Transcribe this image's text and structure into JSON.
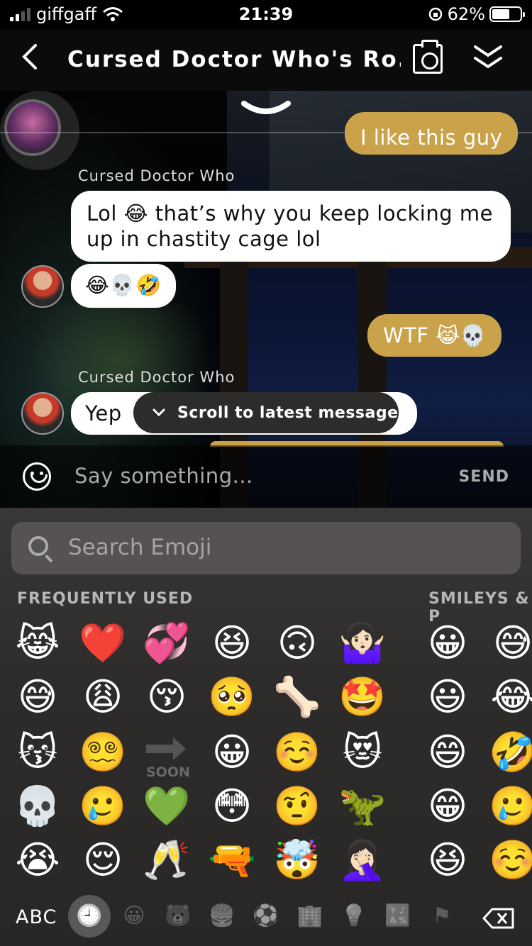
{
  "status": {
    "carrier": "giffgaff",
    "time": "21:39",
    "battery": "62%",
    "battery_level": 0.62
  },
  "header": {
    "title": "Cursed Doctor Who's Ro..."
  },
  "chat": {
    "partial_message": "I like this guy",
    "sender1": "Cursed Doctor Who",
    "msg1": "Lol 😂 that’s why you keep locking me up in chastity cage lol",
    "msg2": "😂💀🤣",
    "msg3": "WTF 😹💀",
    "sender2": "Cursed Doctor Who",
    "msg4": "Yep",
    "scroll_label": "Scroll to latest message"
  },
  "input": {
    "placeholder": "Say something...",
    "send": "SEND"
  },
  "keyboard": {
    "search_placeholder": "Search Emoji",
    "section_frequent": "FREQUENTLY USED",
    "section_smileys": "SMILEYS & P",
    "soon": "SOON",
    "abc": "ABC",
    "frequent": [
      [
        "😹",
        "❤️",
        "💞",
        "😆",
        "🙃",
        "🤷🏻‍♀️"
      ],
      [
        "😅",
        "😩",
        "😚",
        "🥺",
        "🦴",
        "🤩"
      ],
      [
        "😽",
        "😵‍💫",
        "",
        "😀",
        "☺️",
        "😻"
      ],
      [
        "💀",
        "🥲",
        "💚",
        "😳",
        "🤨",
        "🦖"
      ],
      [
        "😭",
        "😌",
        "🥂",
        "🔫",
        "🤯",
        "🤦🏻‍♀️"
      ]
    ],
    "smileys": [
      [
        "😀",
        "😅"
      ],
      [
        "😃",
        "😂"
      ],
      [
        "😄",
        "🤣"
      ],
      [
        "😁",
        "🥲"
      ],
      [
        "😆",
        "☺️"
      ]
    ],
    "tabs": [
      "🕘",
      "😀",
      "🐻",
      "🍔",
      "⚽",
      "🏢",
      "💡",
      "🔣",
      "⚑"
    ]
  }
}
